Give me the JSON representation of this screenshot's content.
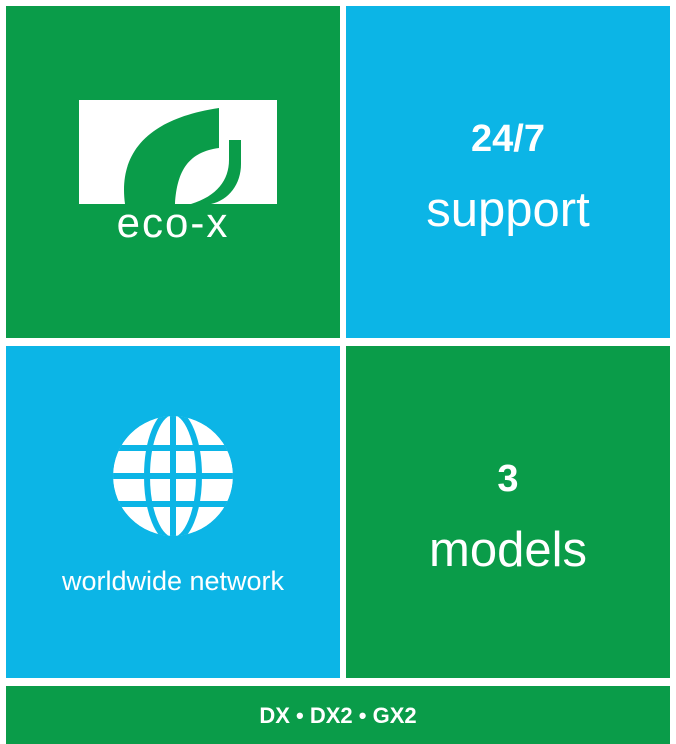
{
  "colors": {
    "green": "#0a9c49",
    "blue": "#0cb5e6",
    "text": "#ffffff"
  },
  "logo": {
    "icon": "leaf-logo-icon",
    "brand_name": "eco-x"
  },
  "support": {
    "number": "24/7",
    "label": "support"
  },
  "network": {
    "icon": "globe-icon",
    "label": "worldwide network"
  },
  "models": {
    "number": "3",
    "label": "models"
  },
  "footer": {
    "text": "DX • DX2 • GX2"
  }
}
